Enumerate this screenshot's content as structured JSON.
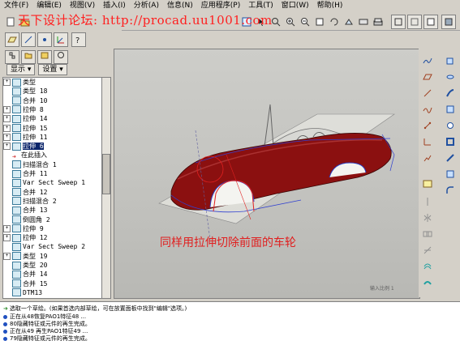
{
  "menubar": {
    "items": [
      "文件(F)",
      "编辑(E)",
      "视图(V)",
      "插入(I)",
      "分析(A)",
      "信息(N)",
      "应用程序(P)",
      "工具(T)",
      "窗口(W)",
      "帮助(H)"
    ]
  },
  "watermark": "天下设计论坛: http://procad.uu1001.com",
  "panel": {
    "display_label": "显示 ▾",
    "settings_label": "设置 ▾"
  },
  "tree": {
    "items": [
      {
        "label": "类型",
        "ex": "+"
      },
      {
        "label": "类型 18",
        "ex": ""
      },
      {
        "label": "合并 10",
        "ex": ""
      },
      {
        "label": "拉伸 8",
        "ex": "+"
      },
      {
        "label": "拉伸 14",
        "ex": "+"
      },
      {
        "label": "拉伸 15",
        "ex": "+"
      },
      {
        "label": "拉伸 11",
        "ex": "+"
      },
      {
        "label": "拉伸 6",
        "ex": "+",
        "selected": true
      },
      {
        "label": "在此插入",
        "ex": "",
        "arrow": true
      },
      {
        "label": "扫描混合 1",
        "ex": ""
      },
      {
        "label": "合并 11",
        "ex": ""
      },
      {
        "label": "Var Sect Sweep 1",
        "ex": ""
      },
      {
        "label": "合并 12",
        "ex": ""
      },
      {
        "label": "扫描混合 2",
        "ex": ""
      },
      {
        "label": "合并 13",
        "ex": ""
      },
      {
        "label": "倒圆角 2",
        "ex": ""
      },
      {
        "label": "拉伸 9",
        "ex": "+"
      },
      {
        "label": "拉伸 12",
        "ex": "+"
      },
      {
        "label": "Var Sect Sweep 2",
        "ex": ""
      },
      {
        "label": "类型 19",
        "ex": "+"
      },
      {
        "label": "类型 20",
        "ex": ""
      },
      {
        "label": "合并 14",
        "ex": ""
      },
      {
        "label": "合并 15",
        "ex": ""
      },
      {
        "label": "DTM13",
        "ex": ""
      }
    ]
  },
  "viewport": {
    "caption": "同样用拉伸切除前面的车轮",
    "scale_note": "输入比例 1"
  },
  "status": {
    "messages": [
      {
        "type": "prompt",
        "text": "选取一个草绘。(如果首选内部草绘，可在放置面板中找到\"编辑\"选项。)"
      },
      {
        "type": "info",
        "text": "正在从48恢复PAO1特征48 ..."
      },
      {
        "type": "info",
        "text": "80隐藏特征或元件的再生完成。"
      },
      {
        "type": "info",
        "text": "正在从49 再生PAO1特征49 ..."
      },
      {
        "type": "info",
        "text": "79隐藏特征或元件的再生完成。"
      }
    ]
  },
  "colors": {
    "background": "#d4d0c8",
    "car_body": "#8b1010",
    "selection": "#0a246a",
    "caption": "#e02020",
    "watermark": "#ff2020"
  }
}
